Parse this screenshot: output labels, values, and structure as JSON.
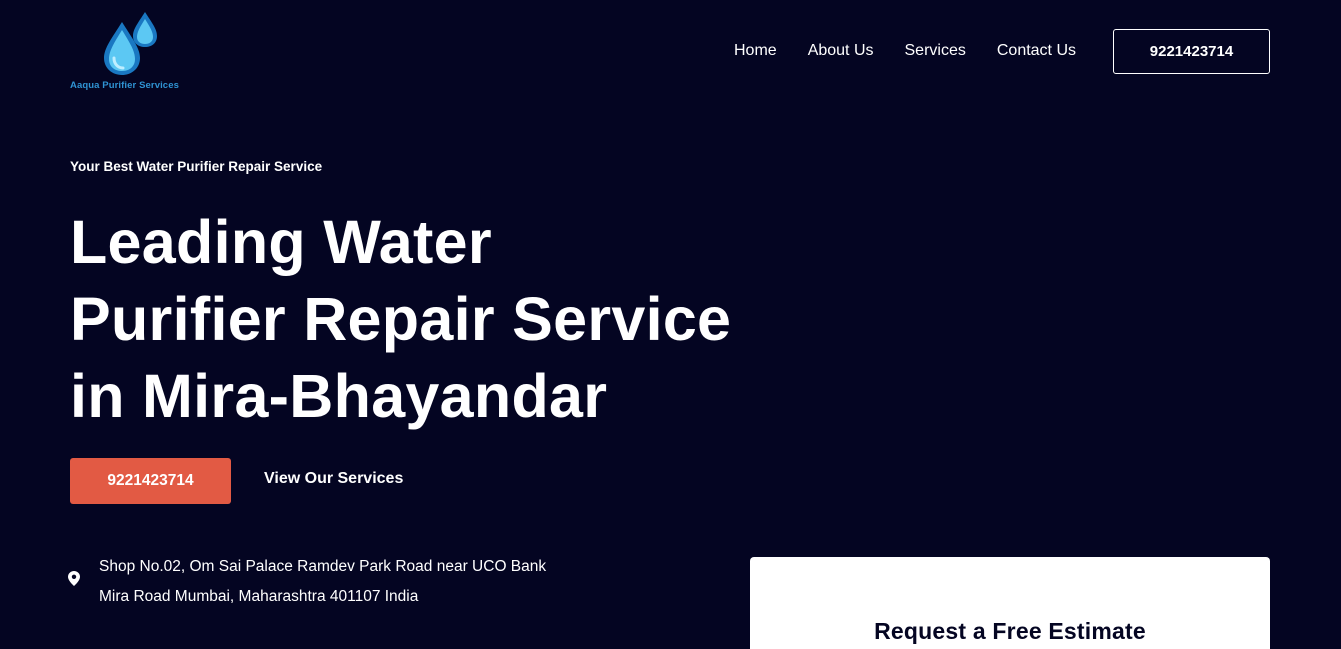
{
  "header": {
    "logo_text": "Aaqua Purifier Services",
    "nav": [
      {
        "label": "Home"
      },
      {
        "label": "About Us"
      },
      {
        "label": "Services"
      },
      {
        "label": "Contact Us"
      }
    ],
    "phone_button": "9221423714"
  },
  "hero": {
    "tagline": "Your Best Water Purifier Repair Service",
    "headline_lines": [
      "Leading Water",
      "Purifier Repair Service",
      "in Mira-Bhayandar"
    ],
    "cta_phone": "9221423714",
    "cta_services": "View Our Services",
    "address_lines": [
      "Shop No.02, Om Sai Palace Ramdev Park Road near UCO Bank",
      "Mira Road Mumbai, Maharashtra 401107 India"
    ],
    "address_icon": "map-pin-icon"
  },
  "estimate_form": {
    "title": "Request a Free Estimate"
  },
  "colors": {
    "background": "#040522",
    "accent": "#e25a44",
    "logo_blue": "#2f93d3",
    "card": "#ffffff"
  }
}
